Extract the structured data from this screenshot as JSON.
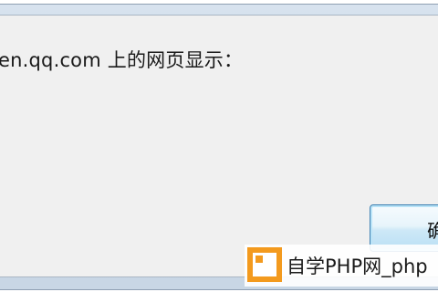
{
  "dialog": {
    "message": "en.qq.com 上的网页显示：",
    "ok_label": "确"
  },
  "watermark": {
    "text": "自学PHP网_php"
  }
}
